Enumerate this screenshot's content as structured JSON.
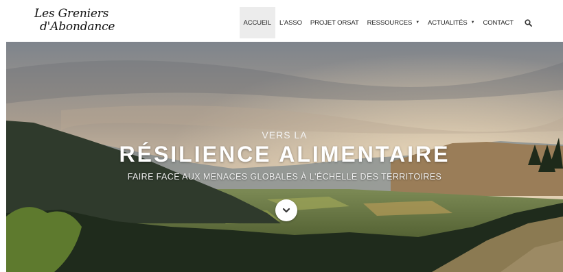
{
  "brand": {
    "line1": "Les Greniers",
    "line2": "d'Abondance"
  },
  "nav": {
    "items": [
      {
        "label": "ACCUEIL",
        "active": true,
        "has_dropdown": false
      },
      {
        "label": "L'ASSO",
        "active": false,
        "has_dropdown": false
      },
      {
        "label": "PROJET ORSAT",
        "active": false,
        "has_dropdown": false
      },
      {
        "label": "RESSOURCES",
        "active": false,
        "has_dropdown": true
      },
      {
        "label": "ACTUALITÉS",
        "active": false,
        "has_dropdown": true
      },
      {
        "label": "CONTACT",
        "active": false,
        "has_dropdown": false
      }
    ],
    "dropdown_caret": "▼",
    "search_icon": "search-icon"
  },
  "hero": {
    "eyebrow": "VERS LA",
    "headline": "RÉSILIENCE ALIMENTAIRE",
    "subline": "FAIRE FACE AUX MENACES GLOBALES À L'ÉCHELLE DES TERRITOIRES",
    "scroll_icon": "chevron-down-icon"
  },
  "colors": {
    "sky_top": "#8a8f98",
    "sky_warm": "#d9c3a8",
    "mountain_dark": "#2f3a2c",
    "valley_green": "#6f7b3a",
    "active_nav_bg": "#ececec"
  }
}
